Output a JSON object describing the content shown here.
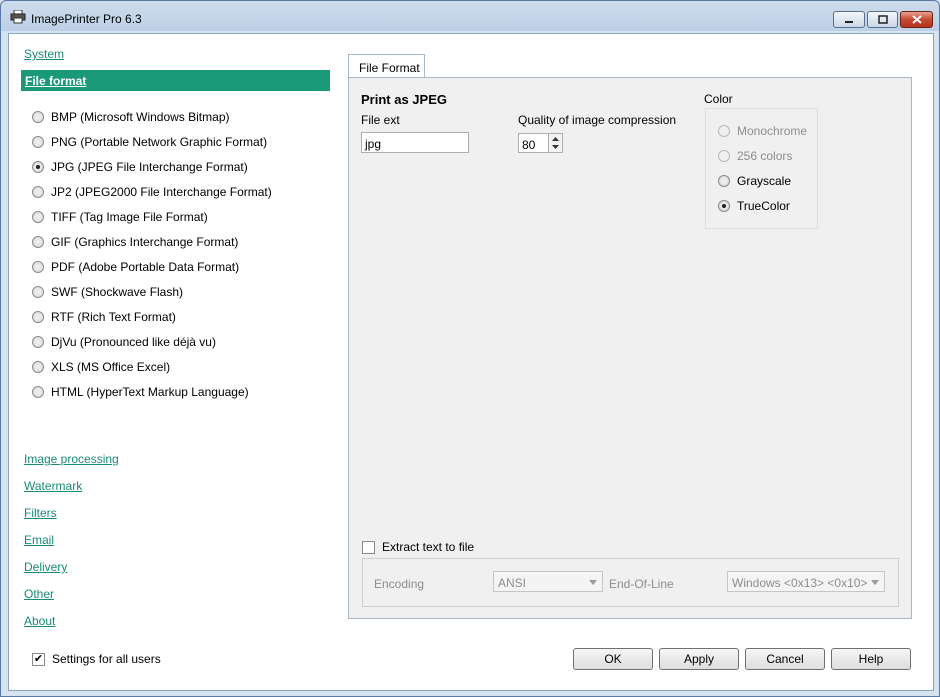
{
  "window": {
    "title": "ImagePrinter Pro 6.3"
  },
  "sidebar": {
    "top_link": "System",
    "selected": "File format",
    "formats": [
      {
        "label": "BMP (Microsoft Windows Bitmap)",
        "checked": false
      },
      {
        "label": "PNG (Portable Network Graphic Format)",
        "checked": false
      },
      {
        "label": "JPG (JPEG File Interchange Format)",
        "checked": true
      },
      {
        "label": "JP2 (JPEG2000 File Interchange Format)",
        "checked": false
      },
      {
        "label": "TIFF (Tag Image File Format)",
        "checked": false
      },
      {
        "label": "GIF (Graphics Interchange Format)",
        "checked": false
      },
      {
        "label": "PDF (Adobe Portable Data Format)",
        "checked": false
      },
      {
        "label": "SWF (Shockwave Flash)",
        "checked": false
      },
      {
        "label": "RTF (Rich Text Format)",
        "checked": false
      },
      {
        "label": "DjVu (Pronounced like déjà vu)",
        "checked": false
      },
      {
        "label": "XLS  (MS Office  Excel)",
        "checked": false
      },
      {
        "label": "HTML (HyperText Markup Language)",
        "checked": false
      }
    ],
    "links": [
      "Image processing",
      "Watermark",
      "Filters",
      "Email",
      "Delivery",
      "Other",
      "About"
    ],
    "settings_all_users": {
      "label": "Settings for all users",
      "checked": true
    }
  },
  "tab": {
    "label": "File Format",
    "heading": "Print as JPEG",
    "file_ext_label": "File ext",
    "file_ext_value": "jpg",
    "quality_label": "Quality of image compression",
    "quality_value": "80",
    "color_label": "Color",
    "color_options": [
      {
        "label": "Monochrome",
        "checked": false,
        "disabled": true
      },
      {
        "label": "256 colors",
        "checked": false,
        "disabled": true
      },
      {
        "label": "Grayscale",
        "checked": false,
        "disabled": false
      },
      {
        "label": "TrueColor",
        "checked": true,
        "disabled": false
      }
    ],
    "extract_text": {
      "label": "Extract text to file",
      "checked": false
    },
    "encoding_label": "Encoding",
    "encoding_value": "ANSI",
    "eol_label": "End-Of-Line",
    "eol_value": "Windows <0x13> <0x10>"
  },
  "buttons": {
    "ok": "OK",
    "apply": "Apply",
    "cancel": "Cancel",
    "help": "Help"
  }
}
